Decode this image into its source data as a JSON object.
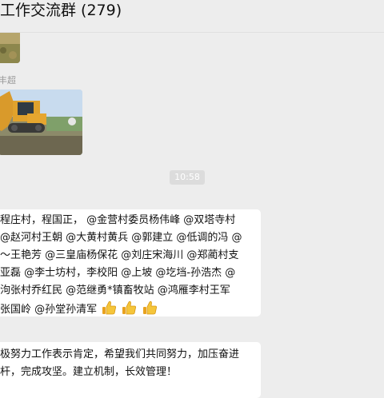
{
  "header": {
    "title": "工作交流群 (279)"
  },
  "messages": {
    "image_a": {
      "icon": "image-thumbnail"
    },
    "sender_name": "丰超",
    "image_b": {
      "icon": "excavator-photo"
    },
    "timestamp": "10:58",
    "text_1": {
      "lines": [
        "程庄村，程国正， @金营村委员杨伟峰 @双塔寺村",
        "@赵河村王朝 @大黄村黄兵 @郭建立 @低调的冯 @",
        "～王艳芳 @三皇庙杨保花 @刘庄宋海川 @郑蔺村支",
        "亚磊 @李士坊村，李校阳 @上坡 @圪垱-孙浩杰 @",
        "泃张村乔红民 @范继勇*镇畜牧站 @鸿雁李村王军",
        "张国岭 @孙堂孙清军"
      ],
      "emoji": [
        "thumbs-up-emoji",
        "thumbs-up-emoji",
        "thumbs-up-emoji"
      ]
    },
    "text_2": {
      "lines": [
        "极努力工作表示肯定，希望我们共同努力，加压奋进",
        "杆，完成攻坚。建立机制，长效管理！"
      ]
    }
  }
}
